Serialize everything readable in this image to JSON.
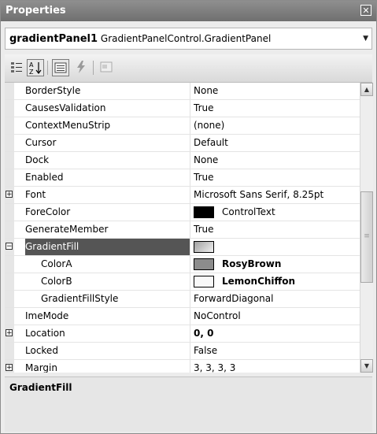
{
  "window": {
    "title": "Properties",
    "close_glyph": "✕"
  },
  "object_selector": {
    "name": "gradientPanel1",
    "type": "GradientPanelControl.GradientPanel",
    "dropdown_glyph": "▼"
  },
  "toolbar": {
    "categorized_icon": "categorized-icon",
    "alphabetical_label": "A↓Z",
    "properties_icon": "properties-icon",
    "events_icon": "lightning-icon",
    "property_pages_icon": "property-pages-icon"
  },
  "rows": [
    {
      "name": "BorderStyle",
      "value": "None"
    },
    {
      "name": "CausesValidation",
      "value": "True"
    },
    {
      "name": "ContextMenuStrip",
      "value": "(none)"
    },
    {
      "name": "Cursor",
      "value": "Default"
    },
    {
      "name": "Dock",
      "value": "None"
    },
    {
      "name": "Enabled",
      "value": "True"
    },
    {
      "name": "Font",
      "value": "Microsoft Sans Serif, 8.25pt",
      "expander": "+"
    },
    {
      "name": "ForeColor",
      "value": "ControlText",
      "swatch": "#000000"
    },
    {
      "name": "GenerateMember",
      "value": "True"
    },
    {
      "name": "GradientFill",
      "value": "",
      "expander": "−",
      "swatch": "#c8c8c8"
    },
    {
      "name": "ColorA",
      "value": "RosyBrown",
      "swatch": "#8c8c8c"
    },
    {
      "name": "ColorB",
      "value": "LemonChiffon",
      "swatch": "#f8f8f8"
    },
    {
      "name": "GradientFillStyle",
      "value": "ForwardDiagonal"
    },
    {
      "name": "ImeMode",
      "value": "NoControl"
    },
    {
      "name": "Location",
      "value": "0, 0",
      "expander": "+"
    },
    {
      "name": "Locked",
      "value": "False"
    },
    {
      "name": "Margin",
      "value": "3, 3, 3, 3",
      "expander": "+"
    }
  ],
  "scrollbar": {
    "up_glyph": "▲",
    "down_glyph": "▼",
    "grip_glyph": "≡"
  },
  "description": {
    "title": "GradientFill"
  }
}
